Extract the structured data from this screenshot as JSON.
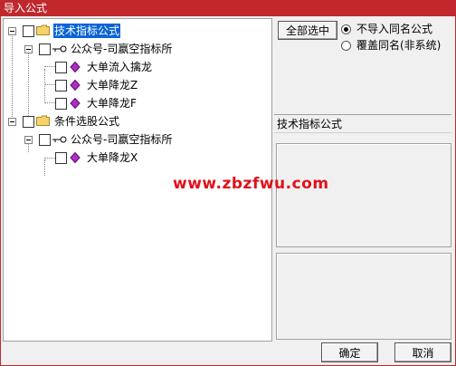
{
  "window": {
    "title": "导入公式"
  },
  "tree": {
    "nodes": [
      {
        "label": "技术指标公式",
        "selected": true
      },
      {
        "label": "公众号-司嬴空指标所"
      },
      {
        "label": "大单流入擒龙"
      },
      {
        "label": "大单降龙Z"
      },
      {
        "label": "大单降龙F"
      },
      {
        "label": "条件选股公式"
      },
      {
        "label": "公众号-司嬴空指标所"
      },
      {
        "label": "大单降龙X"
      }
    ]
  },
  "options": {
    "select_all_label": "全部选中",
    "radio_no_import_label": "不导入同名公式",
    "radio_overwrite_label": "覆盖同名(非系统)",
    "selected_radio": "no_import"
  },
  "details": {
    "caption": "技术指标公式"
  },
  "watermark": "www.zbzfwu.com",
  "buttons": {
    "ok_label": "确定",
    "cancel_label": "取消"
  },
  "colors": {
    "title_bar": "#c0282e",
    "selection": "#0a64d6",
    "watermark": "#e2101a",
    "folder": "#f5d36a",
    "diamond": "#b02cc4"
  }
}
